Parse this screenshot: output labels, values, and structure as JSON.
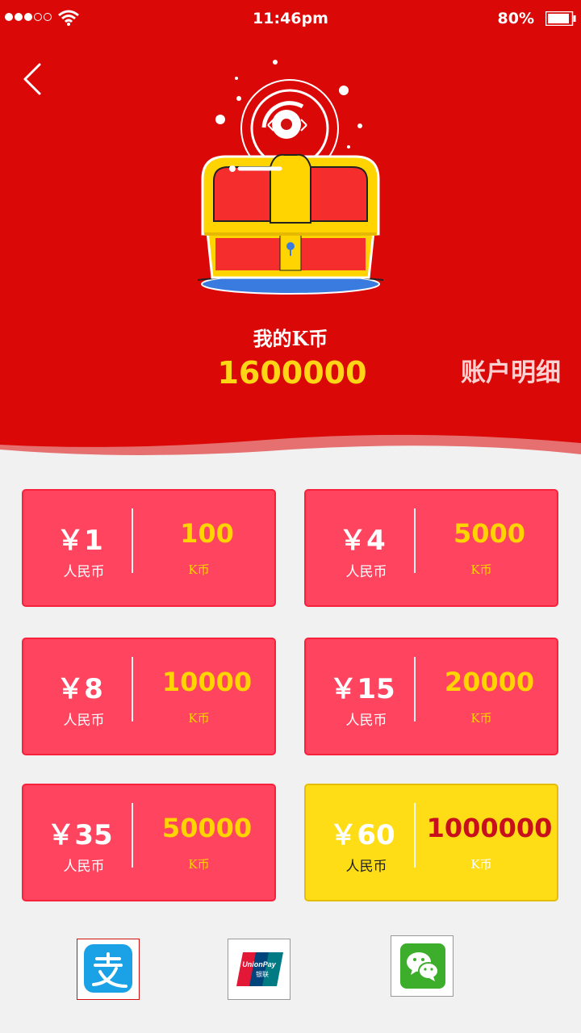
{
  "status_bar": {
    "time": "11:46pm",
    "battery": "80%"
  },
  "header": {
    "my_coins_label": "我的K币",
    "coin_balance": "1600000",
    "account_detail": "账户明细"
  },
  "packages": [
    {
      "price": "￥1",
      "rmb_label": "人民币",
      "coins": "100",
      "unit": "K币",
      "selected": false
    },
    {
      "price": "￥4",
      "rmb_label": "人民币",
      "coins": "5000",
      "unit": "K币",
      "selected": false
    },
    {
      "price": "￥8",
      "rmb_label": "人民币",
      "coins": "10000",
      "unit": "K币",
      "selected": false
    },
    {
      "price": "￥15",
      "rmb_label": "人民币",
      "coins": "20000",
      "unit": "K币",
      "selected": false
    },
    {
      "price": "￥35",
      "rmb_label": "人民币",
      "coins": "50000",
      "unit": "K币",
      "selected": false
    },
    {
      "price": "￥60",
      "rmb_label": "人民币",
      "coins": "1000000",
      "unit": "K币",
      "selected": true
    }
  ],
  "payment_methods": [
    {
      "icon": "alipay-icon",
      "selected": true
    },
    {
      "icon": "unionpay-icon",
      "selected": false,
      "logo_text": "UnionPay 银联"
    },
    {
      "icon": "wechat-pay-icon",
      "selected": false
    }
  ],
  "colors": {
    "header_red": "#db0808",
    "card_pink": "#ff445f",
    "card_selected_yellow": "#fedd17",
    "coin_yellow": "#ffd615",
    "page_bg": "#f1f1f1"
  }
}
